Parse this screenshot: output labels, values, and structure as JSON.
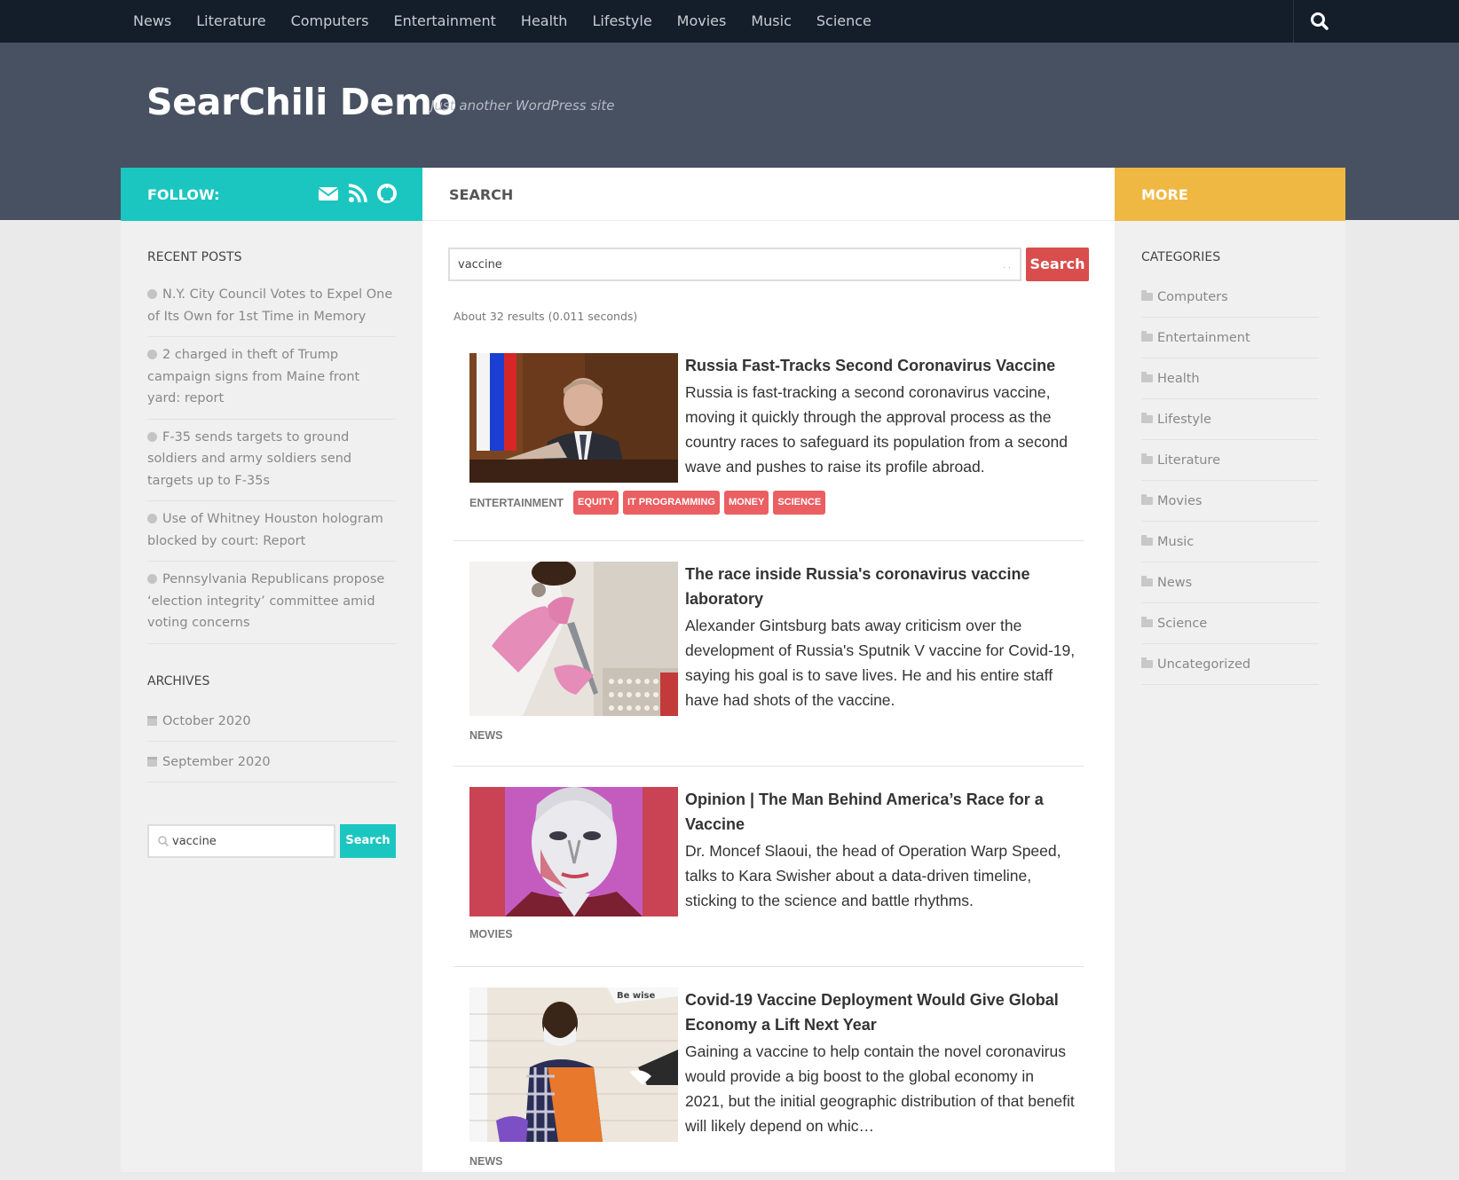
{
  "nav": {
    "items": [
      "News",
      "Literature",
      "Computers",
      "Entertainment",
      "Health",
      "Lifestyle",
      "Movies",
      "Music",
      "Science"
    ],
    "search_icon": "search-icon"
  },
  "site": {
    "title": "SearChili Demo",
    "tagline": "Just another WordPress site"
  },
  "follow": {
    "label": "FOLLOW:",
    "icons": [
      "envelope-icon",
      "rss-icon",
      "github-icon"
    ],
    "color": "#1cc6c0"
  },
  "recent_posts": {
    "title": "RECENT POSTS",
    "items": [
      "N.Y. City Council Votes to Expel One of Its Own for 1st Time in Memory",
      "2 charged in theft of Trump campaign signs from Maine front yard: report",
      "F-35 sends targets to ground soldiers and army soldiers send targets up to F-35s",
      "Use of Whitney Houston hologram blocked by court: Report",
      "Pennsylvania Republicans propose ‘election integrity’ committee amid voting concerns"
    ]
  },
  "archives": {
    "title": "ARCHIVES",
    "items": [
      "October 2020",
      "September 2020"
    ]
  },
  "sidebar_search": {
    "value": "vaccine",
    "button": "Search"
  },
  "main": {
    "heading": "SEARCH",
    "search_value": "vaccine",
    "clear_glyph": ". .",
    "search_button": "Search",
    "result_count": "About 32 results (0.011 seconds)",
    "results": [
      {
        "title": "Russia Fast-Tracks Second Coronavirus Vaccine",
        "text": "Russia is fast-tracking a second coronavirus vaccine, moving it quickly through the approval process as the country races to safeguard its population from a second wave and pushes to raise its profile abroad.",
        "category": "ENTERTAINMENT",
        "tags": [
          "EQUITY",
          "IT PROGRAMMING",
          "MONEY",
          "SCIENCE"
        ]
      },
      {
        "title": "The race inside Russia's coronavirus vaccine laboratory",
        "text": "Alexander Gintsburg bats away criticism over the development of Russia's Sputnik V vaccine for Covid-19, saying his goal is to save lives. He and his entire staff have had shots of the vaccine.",
        "category": "NEWS",
        "tags": []
      },
      {
        "title": "Opinion | The Man Behind America’s Race for a Vaccine",
        "text": "Dr. Moncef Slaoui, the head of Operation Warp Speed, talks to Kara Swisher about a data-driven timeline, sticking to the science and battle rhythms.",
        "category": "MOVIES",
        "tags": []
      },
      {
        "title": "Covid-19 Vaccine Deployment Would Give Global Economy a Lift Next Year",
        "text": "Gaining a vaccine to help contain the novel coronavirus would provide a big boost to the global economy in 2021, but the initial geographic distribution of that benefit will likely depend on whic…",
        "category": "NEWS",
        "tags": [],
        "thumb_sign": "Be wise"
      }
    ]
  },
  "more": {
    "label": "MORE",
    "color": "#efb842"
  },
  "categories": {
    "title": "CATEGORIES",
    "items": [
      "Computers",
      "Entertainment",
      "Health",
      "Lifestyle",
      "Literature",
      "Movies",
      "Music",
      "News",
      "Science",
      "Uncategorized"
    ]
  }
}
